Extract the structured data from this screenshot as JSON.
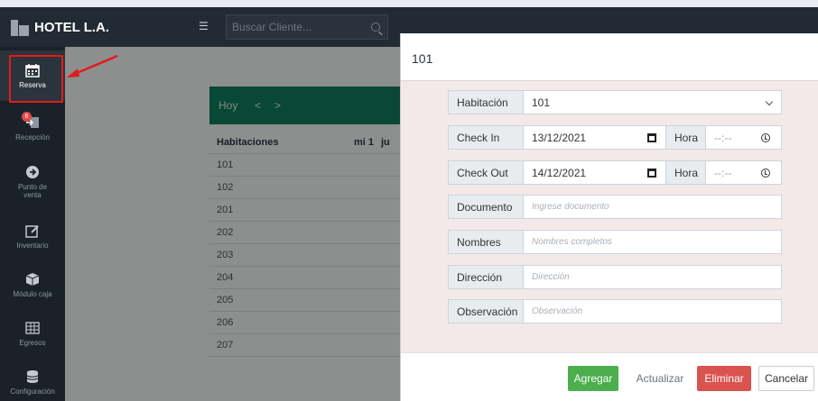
{
  "navbar": {
    "brand": "HOTEL L.A.",
    "search_placeholder": "Buscar Cliente..."
  },
  "sidebar": {
    "items": [
      {
        "label": "Reserva",
        "icon": "calendar-icon",
        "active": true
      },
      {
        "label": "Recepción",
        "icon": "checkin-icon",
        "badge": "6"
      },
      {
        "label": "Punto de venta",
        "icon": "arrow-circle-icon"
      },
      {
        "label": "Inventario",
        "icon": "edit-icon"
      },
      {
        "label": "Módulo caja",
        "icon": "cube-icon"
      },
      {
        "label": "Egresos",
        "icon": "table-icon"
      },
      {
        "label": "Configuración",
        "icon": "database-icon"
      }
    ]
  },
  "calendar": {
    "today_label": "Hoy",
    "prev_label": "<",
    "next_label": ">",
    "table": {
      "headers": [
        "Habitaciones",
        "mi 1",
        "ju"
      ],
      "rows": [
        "101",
        "102",
        "201",
        "202",
        "203",
        "204",
        "205",
        "206",
        "207"
      ]
    }
  },
  "modal": {
    "title": "101",
    "habitacion_label": "Habitación",
    "habitacion_value": "101",
    "checkin_label": "Check In",
    "checkin_value": "13/12/2021",
    "checkout_label": "Check Out",
    "checkout_value": "14/12/2021",
    "hora_label": "Hora",
    "hora_value": "--:--",
    "documento_label": "Documento",
    "documento_placeholder": "Ingrese documento",
    "nombres_label": "Nombres",
    "nombres_placeholder": "Nombres completos",
    "direccion_label": "Dirección",
    "direccion_placeholder": "Dirección",
    "observacion_label": "Observación",
    "observacion_placeholder": "Observación",
    "buttons": {
      "agregar": "Agregar",
      "actualizar": "Actualizar",
      "eliminar": "Eliminar",
      "cancelar": "Cancelar"
    }
  },
  "colors": {
    "navbar": "#222a33",
    "sidebar": "#1b2129",
    "calendar_bar": "#0f7d5a",
    "modal_body": "#f3e9e9",
    "btn_green": "#4cae4c",
    "btn_red": "#d9534f",
    "highlight": "#e21b1b"
  }
}
